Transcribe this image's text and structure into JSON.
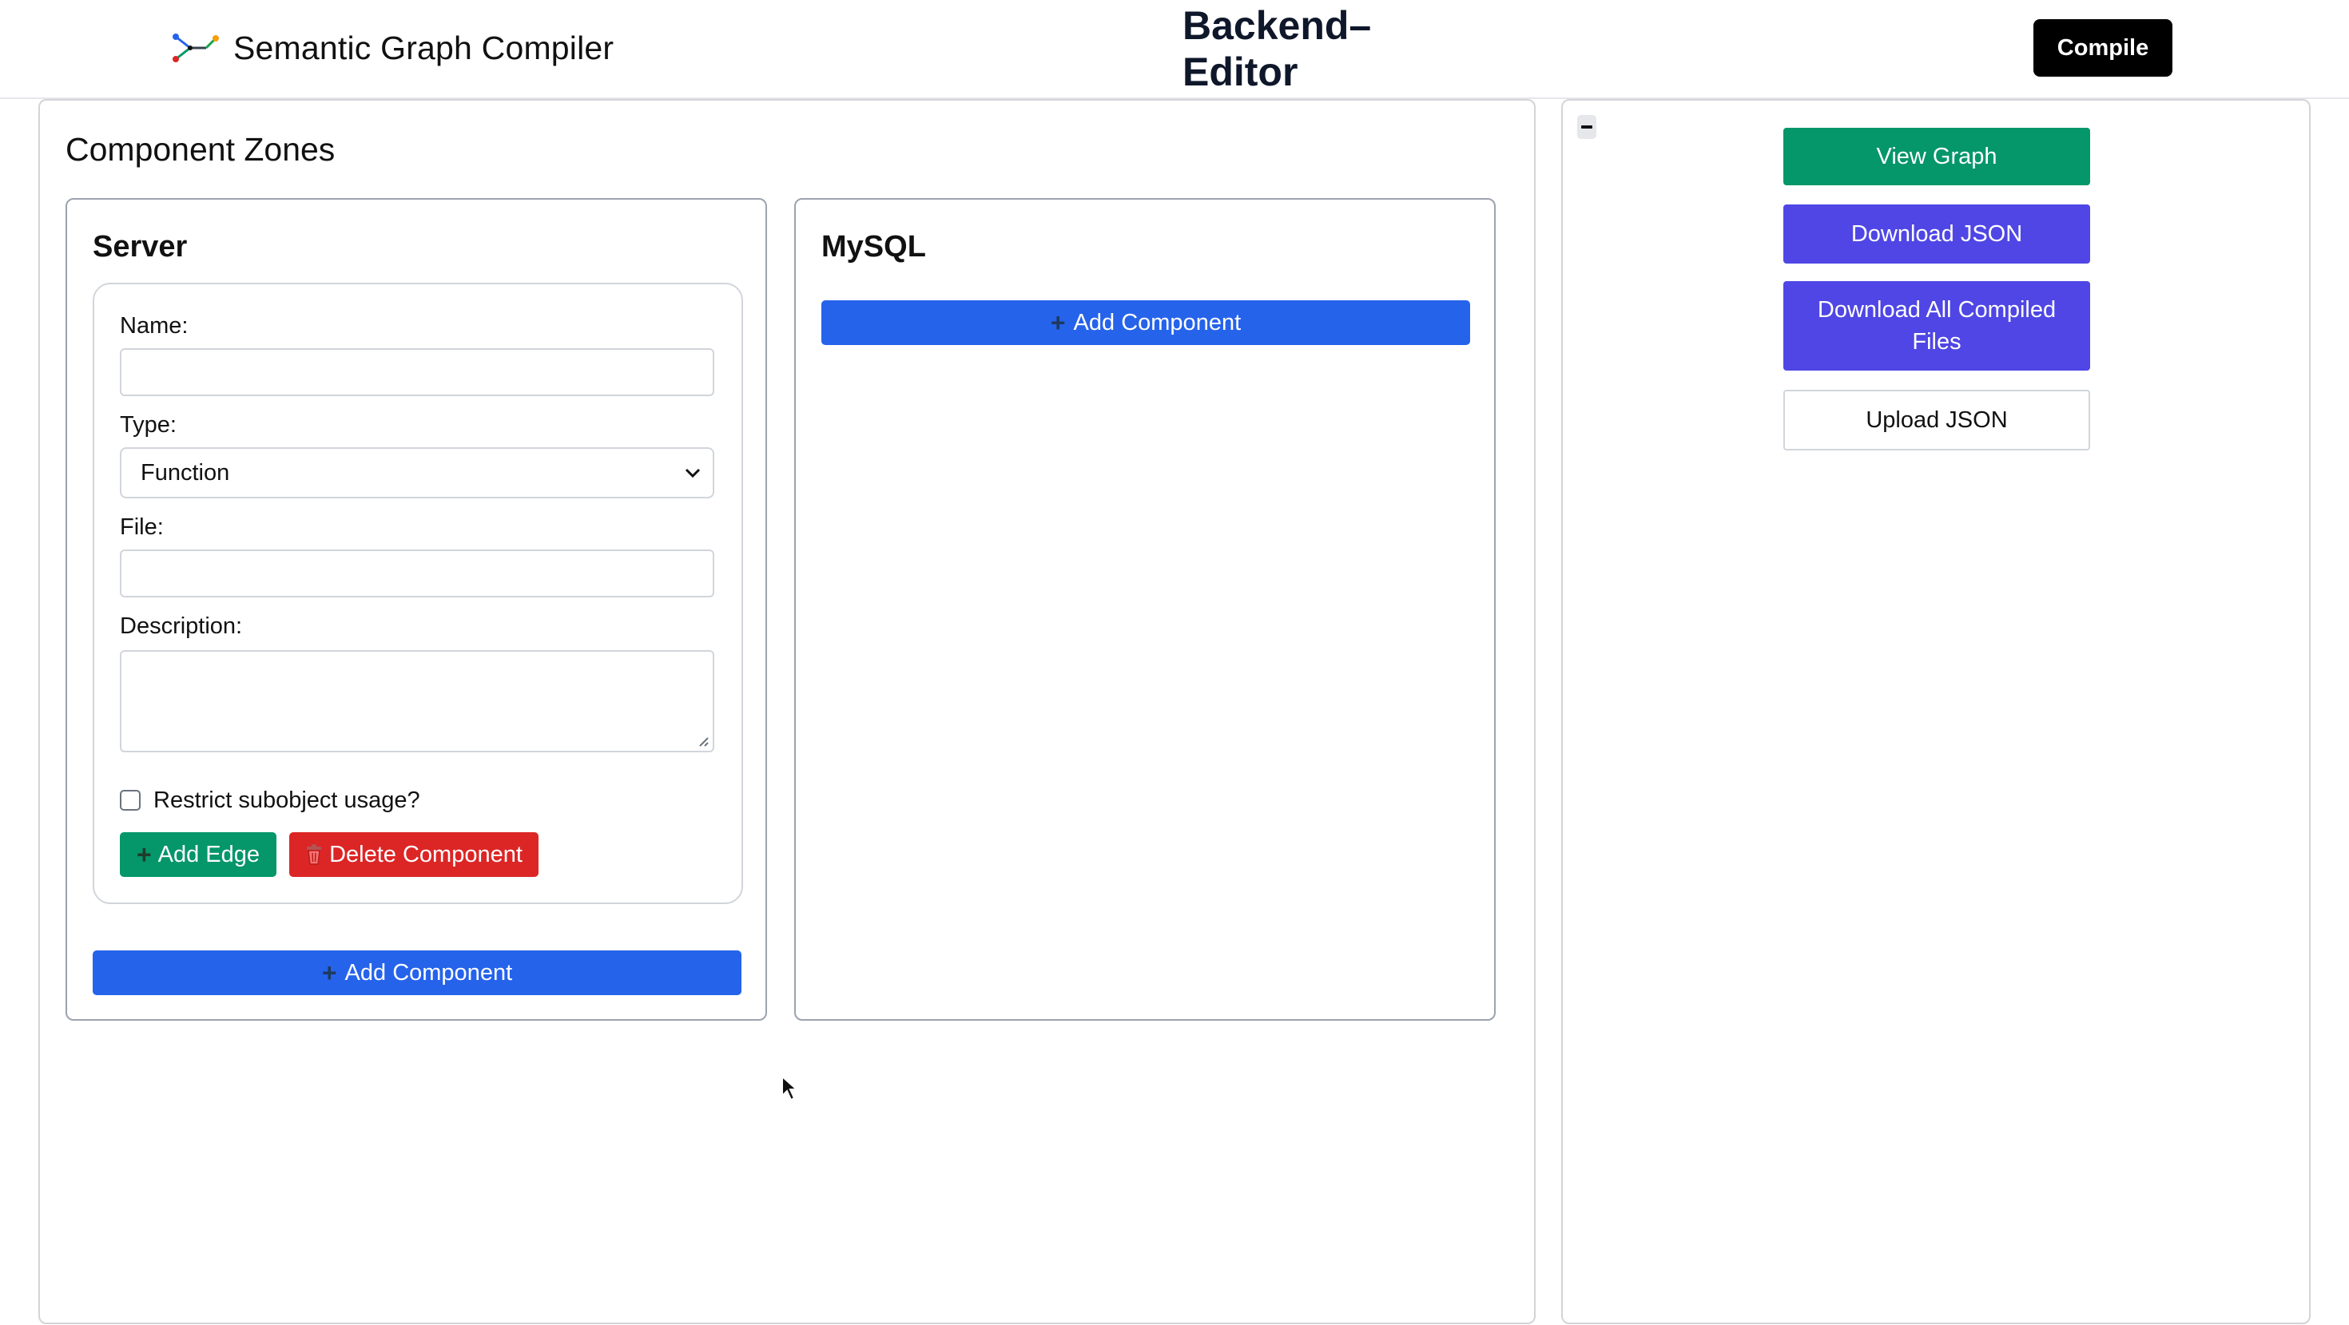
{
  "header": {
    "app_name": "Semantic Graph Compiler",
    "page_title": "Backend–Editor",
    "compile_label": "Compile"
  },
  "zones_panel": {
    "title": "Component Zones",
    "zones": [
      {
        "title": "Server",
        "component": {
          "name_label": "Name:",
          "name_value": "",
          "type_label": "Type:",
          "type_value": "Function",
          "file_label": "File:",
          "file_value": "",
          "description_label": "Description:",
          "description_value": "",
          "restrict_label": "Restrict subobject usage?",
          "restrict_checked": false,
          "add_edge_label": "Add Edge",
          "delete_label": "Delete Component"
        },
        "add_component_label": "Add Component"
      },
      {
        "title": "MySQL",
        "add_component_label": "Add Component"
      }
    ]
  },
  "actions": {
    "view_graph": "View Graph",
    "download_json": "Download JSON",
    "download_all": "Download All Compiled Files",
    "upload_json": "Upload JSON"
  },
  "colors": {
    "green": "#059669",
    "red": "#dc2626",
    "blue": "#2563eb",
    "indigo": "#4f46e5",
    "black": "#000000"
  }
}
